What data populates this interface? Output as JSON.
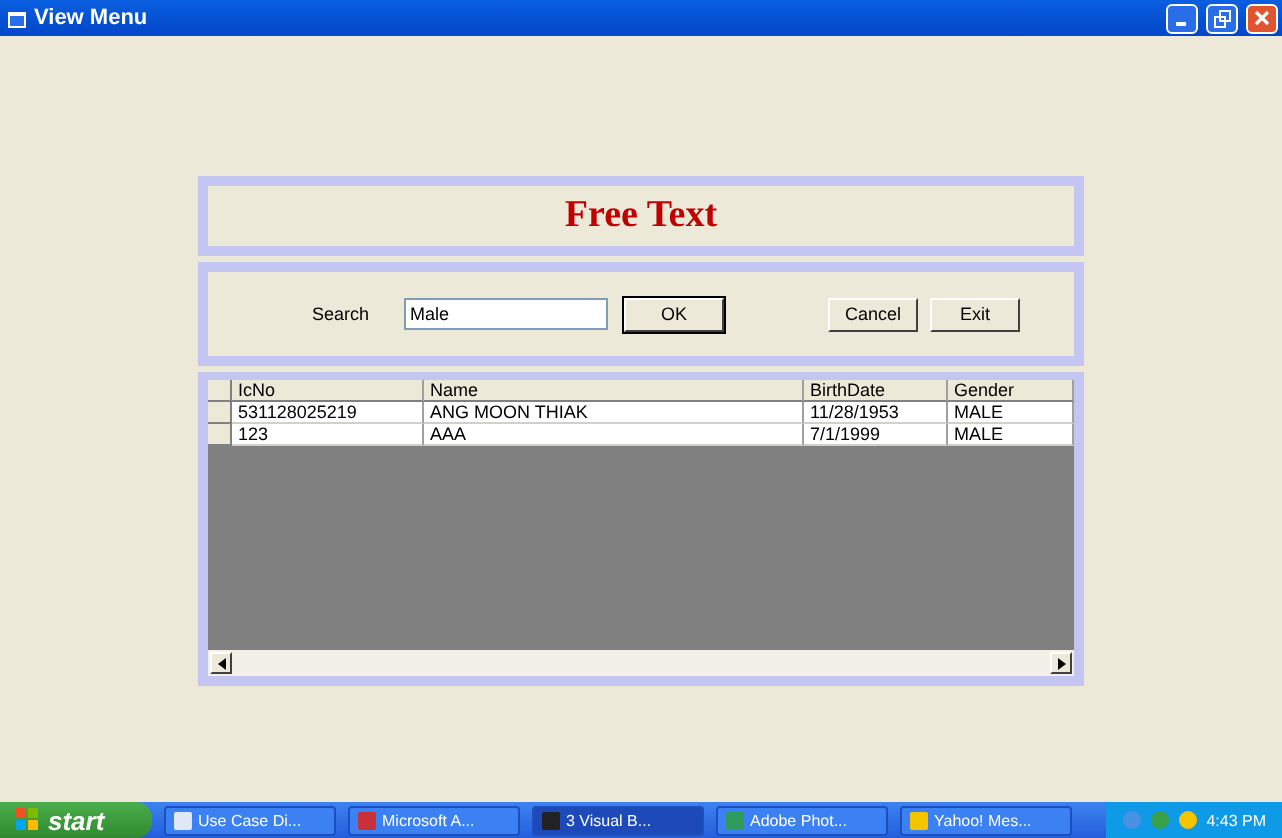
{
  "window": {
    "title": "View Menu"
  },
  "header": {
    "title": "Free Text"
  },
  "search": {
    "label": "Search",
    "value": "Male"
  },
  "buttons": [
    {
      "label": "OK",
      "kind": "default"
    },
    {
      "label": "Cancel",
      "kind": "normal"
    },
    {
      "label": "Exit",
      "kind": "normal"
    }
  ],
  "table": {
    "columns": [
      "IcNo",
      "Name",
      "BirthDate",
      "Gender"
    ],
    "rows": [
      [
        "531128025219",
        "ANG MOON THIAK",
        "11/28/1953",
        "MALE"
      ],
      [
        "123",
        "AAA",
        "7/1/1999",
        "MALE"
      ]
    ]
  },
  "taskbar": {
    "start": "start",
    "items": [
      {
        "label": "Use Case Di...",
        "selected": false
      },
      {
        "label": "Microsoft A...",
        "selected": false
      },
      {
        "label": "3 Visual B...",
        "selected": true
      },
      {
        "label": "Adobe Phot...",
        "selected": false
      },
      {
        "label": "Yahoo! Mes...",
        "selected": false
      }
    ],
    "clock": "4:43 PM"
  }
}
